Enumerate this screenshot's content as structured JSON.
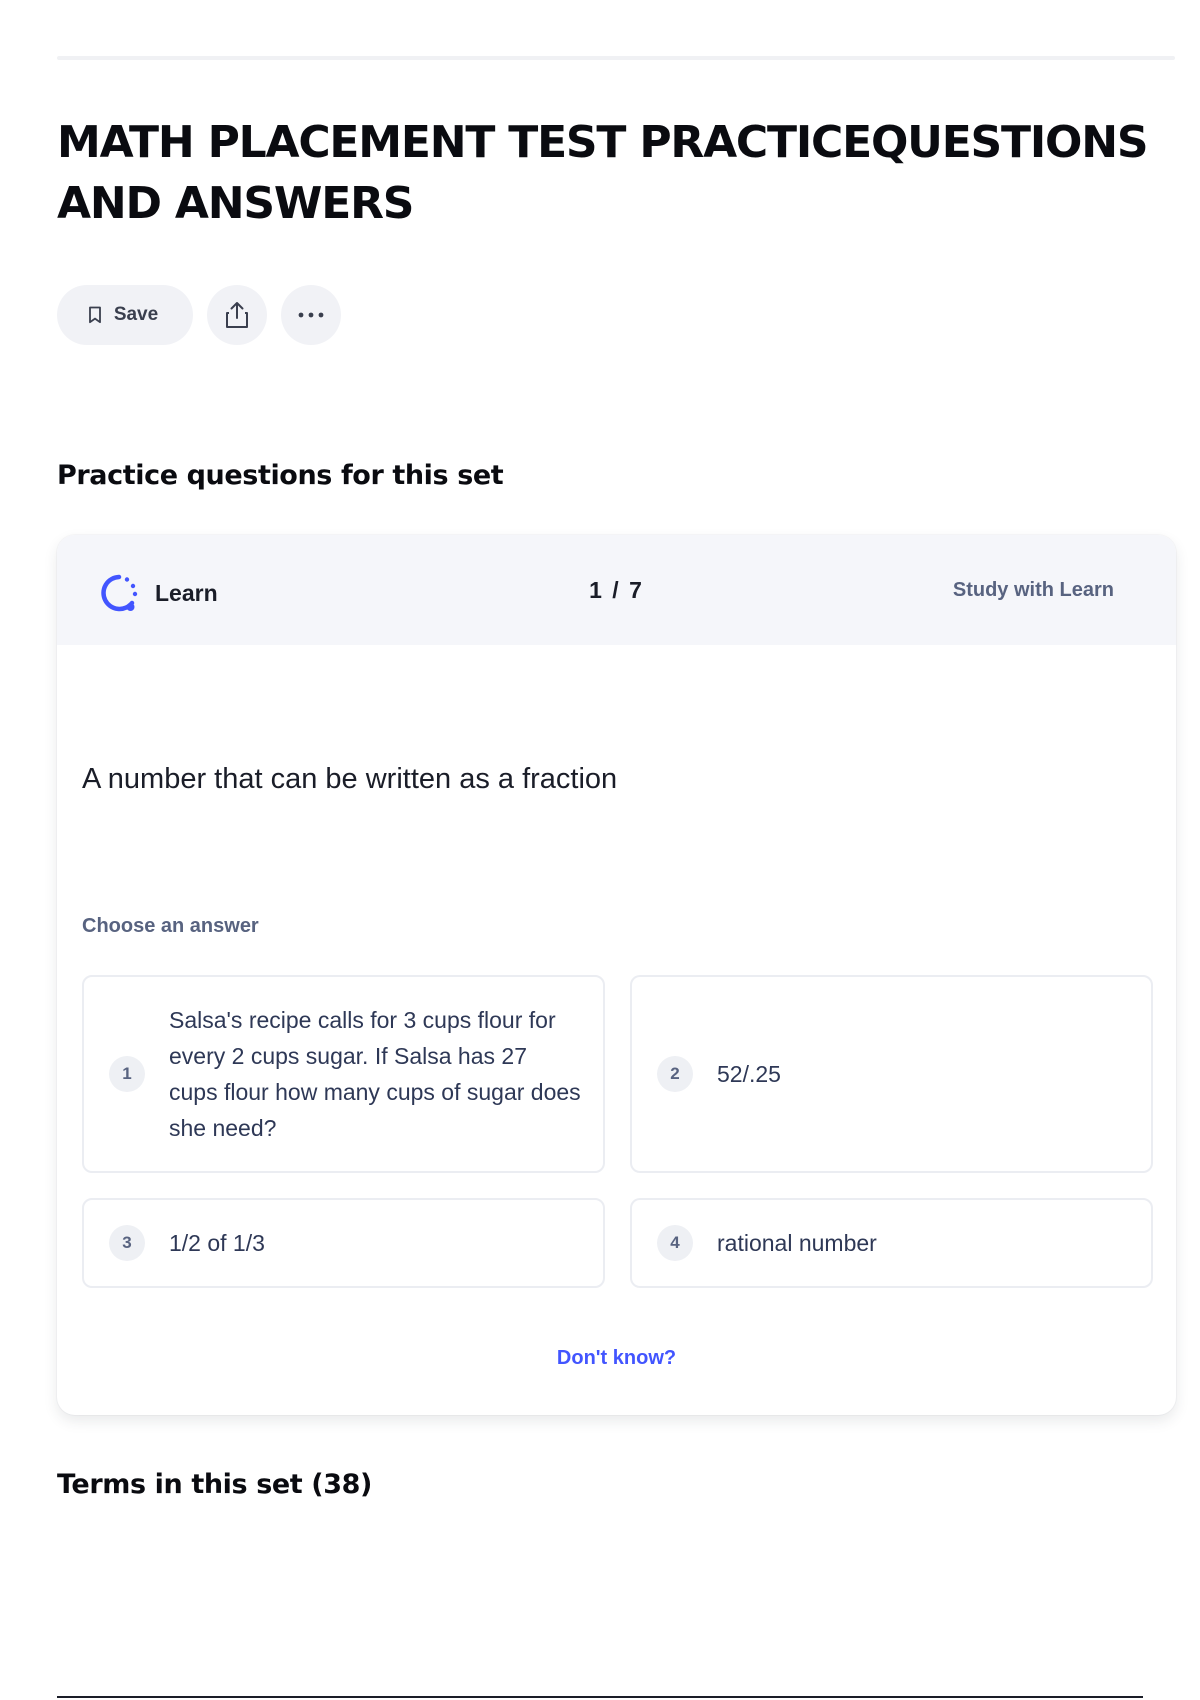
{
  "page": {
    "title": "MATH PLACEMENT TEST PRACTICEQUESTIONS AND ANSWERS"
  },
  "actions": {
    "save_label": "Save",
    "share_icon": "share-icon",
    "more_icon": "more-icon"
  },
  "practice": {
    "heading": "Practice questions for this set",
    "brand_label": "Learn",
    "counter": "1 / 7",
    "study_link": "Study with Learn",
    "question": "A number that can be written as a fraction",
    "choose_label": "Choose an answer",
    "options": [
      {
        "number": "1",
        "text": "Salsa's recipe calls for 3 cups flour for every 2 cups sugar. If Salsa has 27 cups flour how many cups of sugar does she need?"
      },
      {
        "number": "2",
        "text": "52/.25"
      },
      {
        "number": "3",
        "text": "1/2 of 1/3"
      },
      {
        "number": "4",
        "text": "rational number"
      }
    ],
    "dont_know": "Don't know?"
  },
  "terms": {
    "heading": "Terms in this set (38)"
  },
  "colors": {
    "accent": "#4255ff",
    "muted_text": "#586380",
    "header_bg": "#f5f6fa"
  }
}
